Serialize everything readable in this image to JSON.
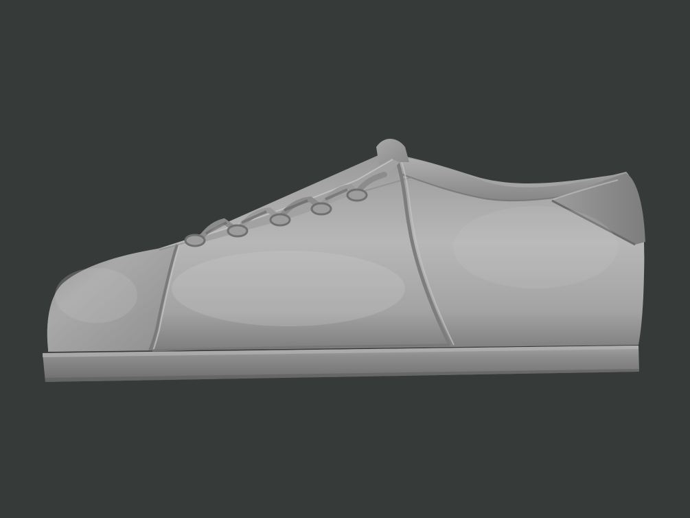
{
  "scene": {
    "subject": "sneaker-3d-sculpt-render",
    "view": "side",
    "colors": {
      "background": "#363b3a",
      "model_base": "#8e8e8e",
      "model_highlight": "#c9c9c9",
      "model_shadow": "#5a5a5a"
    }
  }
}
